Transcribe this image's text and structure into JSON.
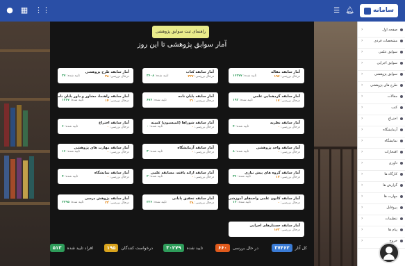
{
  "topbar": {
    "left_icons": [
      "info-icon",
      "grid-icon",
      "apps-icon"
    ],
    "right_icons": [
      "list-icon",
      "bell-icon"
    ],
    "logo_text": "سامانه",
    "accent": "#2a4fa6"
  },
  "main": {
    "guide_button": "راهنمای ثبت سوابق پژوهشی",
    "title": "آمار سوابق پژوهشی تا این روز",
    "cards": [
      {
        "title": "آمار سابقه مقاله",
        "sub_label": "درحال بررسی:",
        "sub_value": "۱۹۷",
        "right_label": "تایید شده:",
        "right_value": "۱۶۲۷۷"
      },
      {
        "title": "آمار سابقه کتاب",
        "sub_label": "درحال بررسی:",
        "sub_value": "۲۲۷",
        "right_label": "تایید شده:",
        "right_value": "۳۶۰۸"
      },
      {
        "title": "آمار سابقه طرح پژوهشی",
        "sub_label": "درحال بررسی:",
        "sub_value": "۳۸",
        "right_label": "تایید شده:",
        "right_value": "۳۷"
      },
      {
        "title": "آمار سابقه گردهمایی علمی",
        "sub_label": "درحال بررسی:",
        "sub_value": "۱۷",
        "right_label": "تایید شده:",
        "right_value": "۱۹۲"
      },
      {
        "title": "آمار سابقه پایان نامه",
        "sub_label": "درحال بررسی:",
        "sub_value": "۲۱",
        "right_label": "تایید شده:",
        "right_value": "۶۷۶"
      },
      {
        "title": "آمار سابقه راهنما، مشاور و داور پایان نامه",
        "sub_label": "درحال بررسی:",
        "sub_value": "۱۴",
        "right_label": "تایید شده:",
        "right_value": "۱۳۶۷"
      },
      {
        "title": "آمار سابقه نظریه",
        "sub_label": "درحال بررسی:",
        "sub_value": "۰",
        "right_label": "تایید شده:",
        "right_value": "۴"
      },
      {
        "title": "آمار سابقه شوراها (کمیسیون) کمیته",
        "sub_label": "درحال بررسی:",
        "sub_value": "۰",
        "right_label": "تایید شده:",
        "right_value": "۰"
      },
      {
        "title": "آمار سابقه اختراع",
        "sub_label": "درحال بررسی:",
        "sub_value": "۰",
        "right_label": "تایید شده:",
        "right_value": "۶"
      },
      {
        "title": "آمار سابقه واحد پژوهشی",
        "sub_label": "درحال بررسی:",
        "sub_value": "۰",
        "right_label": "تایید شده:",
        "right_value": "۸"
      },
      {
        "title": "آمار سابقه آزمایشگاه",
        "sub_label": "درحال بررسی:",
        "sub_value": "۰",
        "right_label": "تایید شده:",
        "right_value": "۳"
      },
      {
        "title": "آمار سابقه مهارت های پژوهشی",
        "sub_label": "درحال بررسی:",
        "sub_value": "۰",
        "right_label": "تایید شده:",
        "right_value": "۱۶"
      },
      {
        "title": "آمار سابقه گروه های پیش نیازی",
        "sub_label": "درحال بررسی:",
        "sub_value": "۱۳",
        "right_label": "تایید شده:",
        "right_value": "۳۶"
      },
      {
        "title": "آمار سابقه ارائه یافته، مسابقه علمی",
        "sub_label": "درحال بررسی:",
        "sub_value": "۰",
        "right_label": "تایید شده:",
        "right_value": "۲"
      },
      {
        "title": "آمار سابقه نمایشگاه",
        "sub_label": "درحال بررسی:",
        "sub_value": "۰",
        "right_label": "تایید شده:",
        "right_value": "۴"
      },
      {
        "title": "آمار سابقه کانون علمی واحدهای آموزشی",
        "sub_label": "درحال بررسی:",
        "sub_value": "۰",
        "right_label": "تایید شده:",
        "right_value": "۱۲"
      },
      {
        "title": "آمار سابقه تحقیق پایانی",
        "sub_label": "درحال بررسی:",
        "sub_value": "۳۸",
        "right_label": "تایید شده:",
        "right_value": "۲۲۶"
      },
      {
        "title": "آمار سابقه پژوهش درسی",
        "sub_label": "درحال بررسی:",
        "sub_value": "۲۳",
        "right_label": "تایید شده:",
        "right_value": "۲۲۹۵"
      },
      {
        "title": "آمار سابقه جستارهای اجرایی",
        "sub_label": "درحال بررسی:",
        "sub_value": "۱۷۲",
        "right_label": "",
        "right_value": ""
      }
    ],
    "stats": [
      {
        "label": "کل آثار",
        "value": "۳۷۴۶۲",
        "color": "#3a7bd5"
      },
      {
        "label": "در حال بررسی",
        "value": "۶۶۰",
        "color": "#e05a1c"
      },
      {
        "label": "تایید شده",
        "value": "۳۰۲۷۹",
        "color": "#2e9c5a"
      },
      {
        "label": "درخواست کنندگان",
        "value": "۱۹۵",
        "color": "#d9a31c"
      },
      {
        "label": "افراد تایید شده",
        "value": "۵۱۳",
        "color": "#2e9c5a"
      }
    ]
  },
  "sidebar": {
    "items": [
      {
        "label": "صفحه اول",
        "icon": "home-icon"
      },
      {
        "label": "مشخصات فردی",
        "icon": "user-icon"
      },
      {
        "label": "سوابق علمی",
        "icon": "book-icon"
      },
      {
        "label": "سوابق اجرایی",
        "icon": "briefcase-icon"
      },
      {
        "label": "سوابق پژوهشی",
        "icon": "flask-icon"
      },
      {
        "label": "طرح های پژوهشی",
        "icon": "doc-icon"
      },
      {
        "label": "مقالات",
        "icon": "paper-icon"
      },
      {
        "label": "کتب",
        "icon": "book2-icon"
      },
      {
        "label": "اختراع",
        "icon": "bulb-icon"
      },
      {
        "label": "آزمایشگاه",
        "icon": "lab-icon"
      },
      {
        "label": "نمایشگاه",
        "icon": "gallery-icon"
      },
      {
        "label": "افتخارات",
        "icon": "award-icon"
      },
      {
        "label": "داوری",
        "icon": "scale-icon"
      },
      {
        "label": "کارگاه ها",
        "icon": "tools-icon"
      },
      {
        "label": "گزارش ها",
        "icon": "chart-icon"
      },
      {
        "label": "مهارت ها",
        "icon": "star-icon"
      },
      {
        "label": "پروفایل",
        "icon": "profile-icon"
      },
      {
        "label": "تنظیمات",
        "icon": "gear-icon"
      },
      {
        "label": "پیام ها",
        "icon": "mail-icon"
      },
      {
        "label": "خروج",
        "icon": "logout-icon"
      }
    ]
  }
}
